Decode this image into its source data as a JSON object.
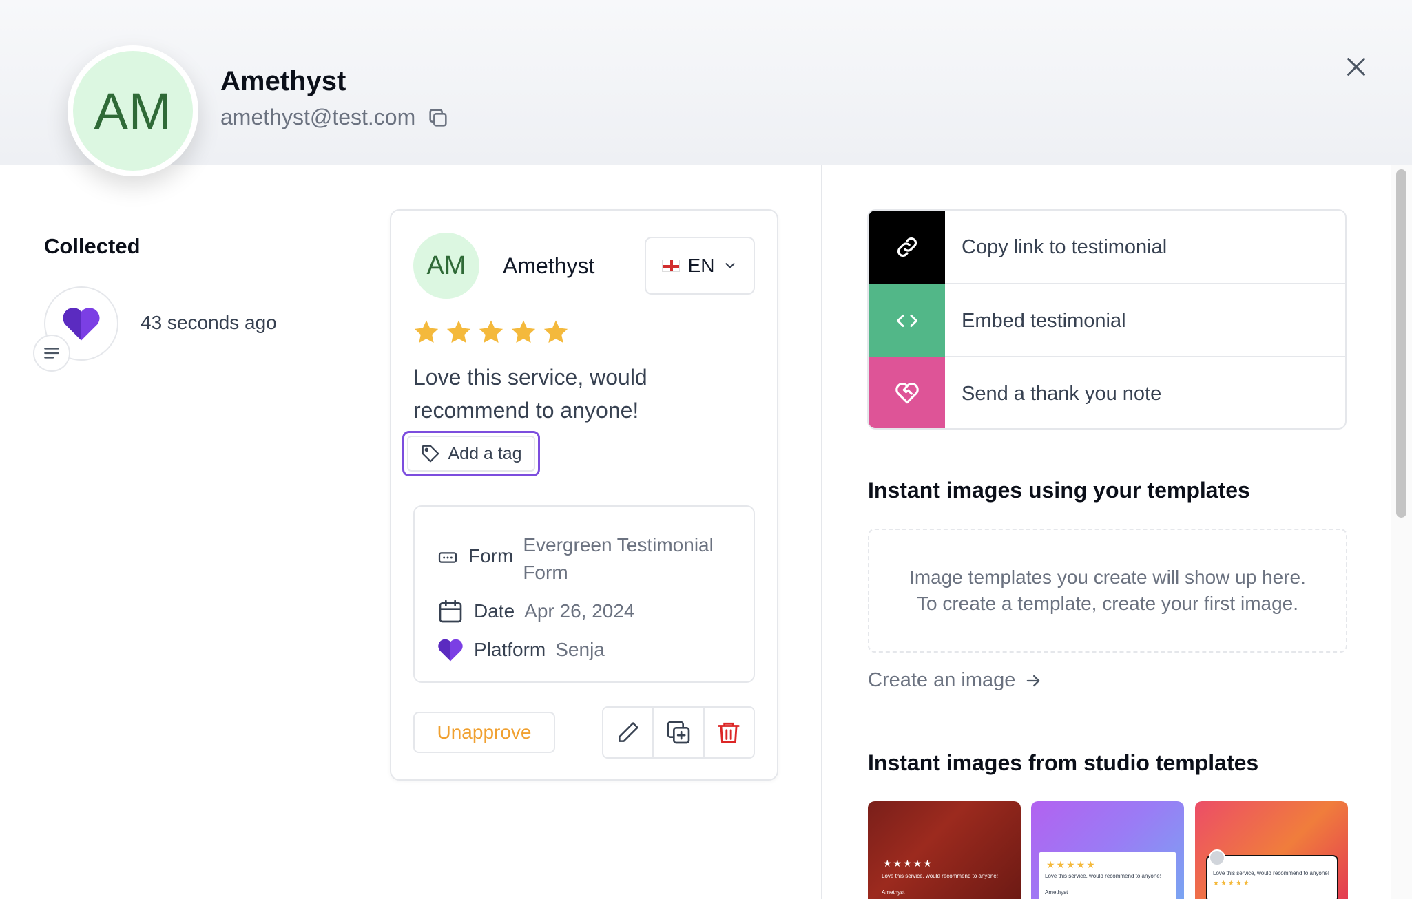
{
  "header": {
    "avatar_initials": "AM",
    "name": "Amethyst",
    "email": "amethyst@test.com"
  },
  "left": {
    "collected_title": "Collected",
    "time_ago": "43 seconds ago"
  },
  "card": {
    "avatar_initials": "AM",
    "name": "Amethyst",
    "language": "EN",
    "rating": 5,
    "text": "Love this service, would recommend to anyone!",
    "add_tag_label": "Add a tag",
    "details": {
      "form_label": "Form",
      "form_value": "Evergreen Testimonial Form",
      "date_label": "Date",
      "date_value": "Apr 26, 2024",
      "platform_label": "Platform",
      "platform_value": "Senja"
    },
    "unapprove_label": "Unapprove"
  },
  "share": {
    "copy_link_label": "Copy link to testimonial",
    "embed_label": "Embed testimonial",
    "thank_you_label": "Send a thank you note"
  },
  "templates": {
    "your_title": "Instant images using your templates",
    "empty_line_1": "Image templates you create will show up here.",
    "empty_line_2": "To create a template, create your first image.",
    "create_link": "Create an image",
    "studio_title": "Instant images from studio templates",
    "thumbs": [
      {
        "stars": "★★★★★",
        "text": "Love this service, would recommend to anyone!",
        "author": "Amethyst"
      },
      {
        "stars": "★★★★★",
        "text": "Love this service, would recommend to anyone!",
        "author": "Amethyst"
      },
      {
        "stars": "★★★★★",
        "text": "Love this service, would recommend to anyone!",
        "author": ""
      }
    ]
  },
  "colors": {
    "avatar_bg": "#dcf7e1",
    "avatar_text": "#2f6a37",
    "star": "#f4b93c",
    "copy_link_bg": "#000000",
    "embed_bg": "#52b788",
    "thank_you_bg": "#de5497",
    "tag_outline": "#7c4dde",
    "unapprove": "#f0a030",
    "delete": "#dc2626"
  }
}
